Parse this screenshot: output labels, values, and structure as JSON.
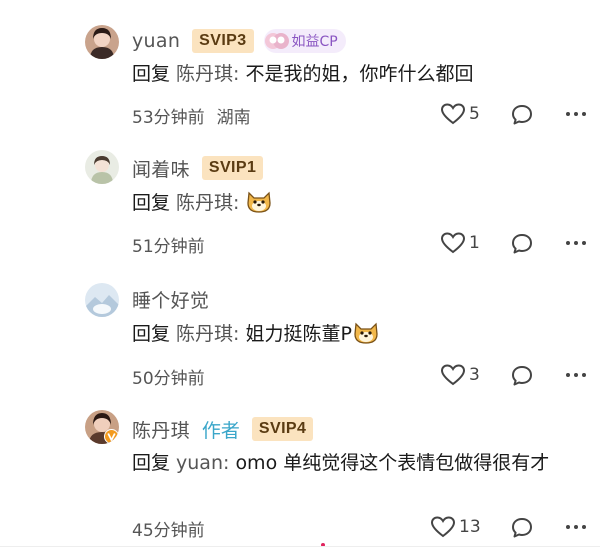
{
  "comments": [
    {
      "username": "yuan",
      "svip": "SVIP3",
      "badge": "如益CP",
      "reply_prefix": "回复",
      "reply_target": "陈丹琪:",
      "text": "不是我的姐，你咋什么都回",
      "timestamp": "53分钟前",
      "location": "湖南",
      "likes": "5"
    },
    {
      "username": "闻着味",
      "svip": "SVIP1",
      "reply_prefix": "回复",
      "reply_target": "陈丹琪:",
      "text": "",
      "timestamp": "51分钟前",
      "likes": "1"
    },
    {
      "username": "睡个好觉",
      "reply_prefix": "回复",
      "reply_target": "陈丹琪:",
      "text": "姐力挺陈董P",
      "timestamp": "50分钟前",
      "likes": "3"
    },
    {
      "username": "陈丹琪",
      "author_tag": "作者",
      "svip": "SVIP4",
      "reply_prefix": "回复",
      "reply_target": "yuan:",
      "text": "omo 单纯觉得这个表情包做得很有才",
      "timestamp": "45分钟前",
      "likes": "13"
    }
  ],
  "icons": {
    "like": "heart-outline-icon",
    "reply": "chat-bubble-icon",
    "more": "more-dots-icon",
    "sticker": "shiba-dog-sticker"
  },
  "colors": {
    "svip_bg": "#fbe3bf",
    "svip_text": "#5a3b12",
    "author_tag": "#3aa6c9",
    "cp_badge": "#8a55c2"
  }
}
